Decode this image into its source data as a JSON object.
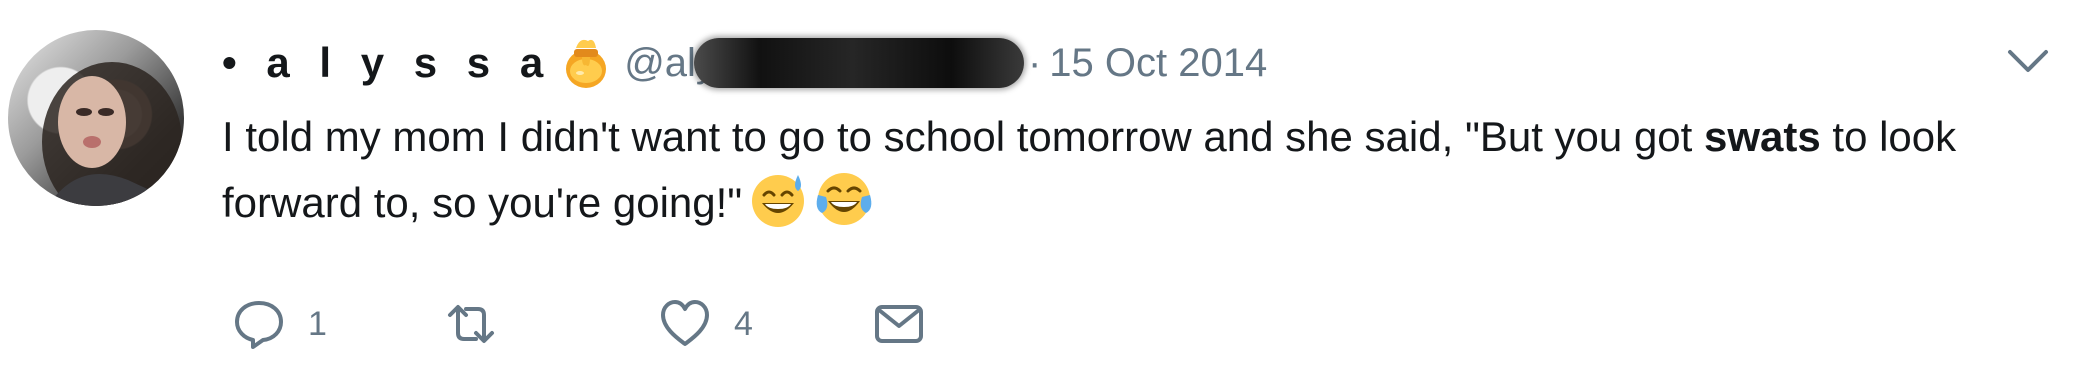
{
  "tweet": {
    "display_name": "• a l y s s a",
    "handle_visible": "@aly",
    "separator": "·",
    "timestamp": "15 Oct 2014",
    "text_part1": "I told my mom I didn't want to go to school tomorrow and she said, \"But you got ",
    "text_bold": "swats",
    "text_part2": " to look forward to, so you're going!\"",
    "emojis": [
      "sweat-smile-emoji",
      "tears-of-joy-emoji"
    ]
  },
  "actions": {
    "reply_count": "1",
    "retweet_count": "",
    "like_count": "4"
  },
  "icons": {
    "name_badge": "honey-pot-icon",
    "menu": "chevron-down-icon",
    "reply": "reply-icon",
    "retweet": "retweet-icon",
    "like": "heart-icon",
    "message": "envelope-icon"
  },
  "colors": {
    "text": "#14171a",
    "secondary": "#657786",
    "icon": "#657786"
  }
}
